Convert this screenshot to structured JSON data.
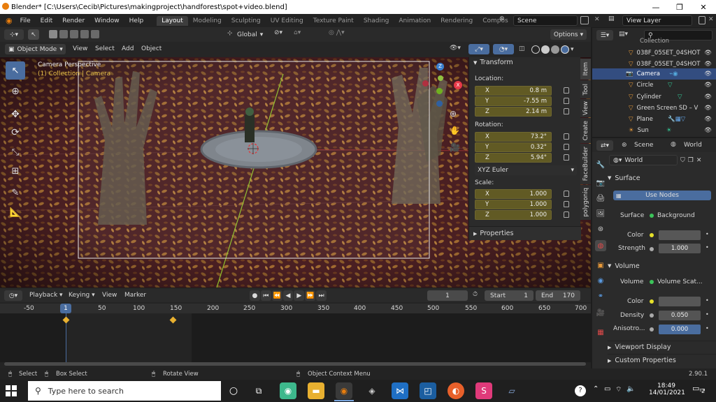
{
  "window": {
    "title": "Blender* [C:\\Users\\Cecib\\Pictures\\makingproject\\handforest\\spot+video.blend]"
  },
  "menus": [
    "File",
    "Edit",
    "Render",
    "Window",
    "Help"
  ],
  "workspaces": [
    "Layout",
    "Modeling",
    "Sculpting",
    "UV Editing",
    "Texture Paint",
    "Shading",
    "Animation",
    "Rendering",
    "Compos"
  ],
  "scene": {
    "name": "Scene",
    "view_layer": "View Layer"
  },
  "tool_header": {
    "orientation": "Global",
    "options": "Options"
  },
  "viewport_header": {
    "mode": "Object Mode",
    "menus": [
      "View",
      "Select",
      "Add",
      "Object"
    ]
  },
  "viewport": {
    "overlay_title": "Camera Perspective",
    "overlay_sub": "(1) Collection | Camera"
  },
  "npanel": {
    "section": "Transform",
    "location_label": "Location:",
    "location": [
      {
        "axis": "X",
        "value": "0.8 m"
      },
      {
        "axis": "Y",
        "value": "-7.55 m"
      },
      {
        "axis": "Z",
        "value": "2.14 m"
      }
    ],
    "rotation_label": "Rotation:",
    "rotation": [
      {
        "axis": "X",
        "value": "73.2°"
      },
      {
        "axis": "Y",
        "value": "0.32°"
      },
      {
        "axis": "Z",
        "value": "5.94°"
      }
    ],
    "rotation_mode": "XYZ Euler",
    "scale_label": "Scale:",
    "scale": [
      {
        "axis": "X",
        "value": "1.000"
      },
      {
        "axis": "Y",
        "value": "1.000"
      },
      {
        "axis": "Z",
        "value": "1.000"
      }
    ],
    "properties": "Properties",
    "tabs": [
      "Item",
      "Tool",
      "View",
      "Create",
      "FaceBuilder",
      "polygoniq"
    ]
  },
  "outliner": {
    "items": [
      {
        "label": "Collection"
      },
      {
        "label": "038F_05SET_04SHOT"
      },
      {
        "label": "038F_05SET_04SHOT"
      },
      {
        "label": "Camera"
      },
      {
        "label": "Circle"
      },
      {
        "label": "Cylinder"
      },
      {
        "label": "Green Screen SD – V"
      },
      {
        "label": "Plane"
      },
      {
        "label": "Sun"
      }
    ]
  },
  "properties": {
    "breadcrumb_scene": "Scene",
    "breadcrumb_world": "World",
    "world_name": "World",
    "surface_header": "Surface",
    "use_nodes": "Use Nodes",
    "surface_label": "Surface",
    "surface_value": "Background",
    "color_label": "Color",
    "strength_label": "Strength",
    "strength_value": "1.000",
    "volume_header": "Volume",
    "volume_label": "Volume",
    "volume_value": "Volume Scat...",
    "vcolor_label": "Color",
    "density_label": "Density",
    "density_value": "0.050",
    "aniso_label": "Anisotro...",
    "aniso_value": "0.000",
    "viewport_display": "Viewport Display",
    "custom_properties": "Custom Properties"
  },
  "timeline": {
    "menus": [
      "Playback",
      "Keying",
      "View",
      "Marker"
    ],
    "current_frame": "1",
    "start_label": "Start",
    "start": "1",
    "end_label": "End",
    "end": "170",
    "ruler": [
      "-50",
      "1",
      "50",
      "100",
      "150",
      "200",
      "250",
      "300",
      "350",
      "400",
      "450",
      "500",
      "550",
      "600",
      "650",
      "700"
    ]
  },
  "statusbar": {
    "select": "Select",
    "box_select": "Box Select",
    "rotate": "Rotate View",
    "context": "Object Context Menu",
    "version": "2.90.1"
  },
  "taskbar": {
    "search_placeholder": "Type here to search",
    "time": "18:49",
    "date": "14/01/2021",
    "notif": "2"
  }
}
